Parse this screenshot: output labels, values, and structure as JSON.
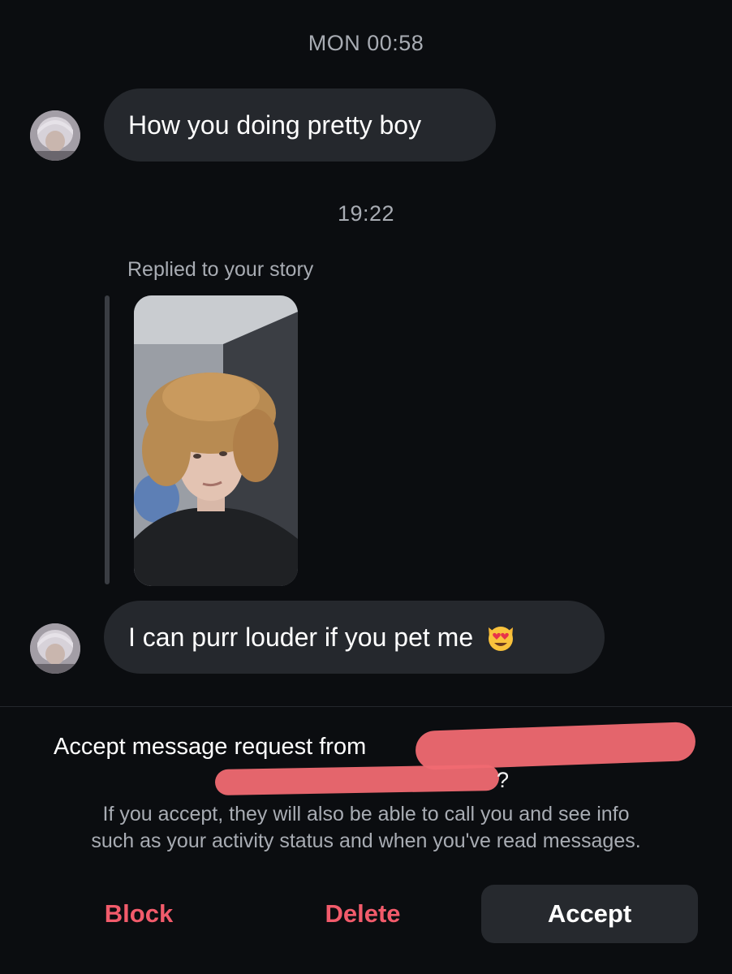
{
  "conversation": {
    "timestamp_1": "MON 00:58",
    "message_1": "How you doing pretty boy",
    "timestamp_2": "19:22",
    "replied_label": "Replied to your story",
    "message_2": "I can purr louder if you pet me",
    "message_2_emoji_icon": "heart-eyes-cat-icon"
  },
  "request": {
    "title": "Accept message request from",
    "title_suffix": "?",
    "info_line_1": "If you accept, they will also be able to call you and see info",
    "info_line_2": "such as your activity status and when you've read messages."
  },
  "actions": {
    "block_label": "Block",
    "delete_label": "Delete",
    "accept_label": "Accept"
  },
  "colors": {
    "background": "#0b0d10",
    "bubble": "#25282d",
    "danger": "#f25b6b",
    "muted_text": "#a8acb3",
    "redaction": "#f06a72"
  }
}
